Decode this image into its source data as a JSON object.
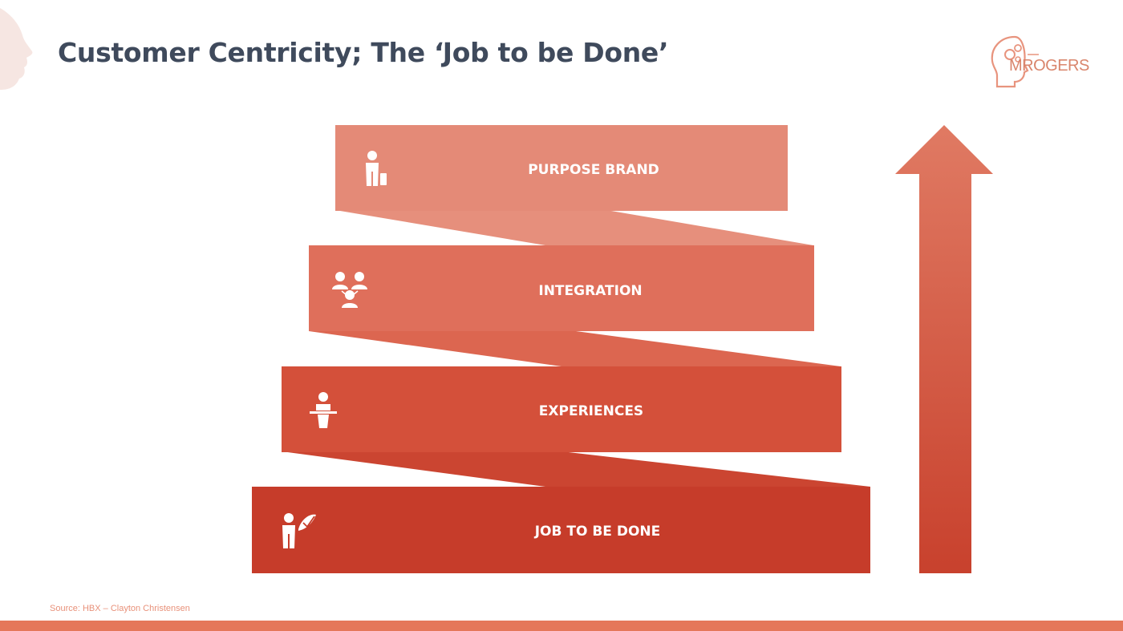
{
  "title": "Customer Centricity; The ‘Job to be Done’",
  "logo": {
    "text": "MROGERS"
  },
  "steps": [
    {
      "label": "PURPOSE BRAND",
      "icon": "businessman-icon",
      "color": "#e48a77"
    },
    {
      "label": "INTEGRATION",
      "icon": "group-network-icon",
      "color": "#df6f5b"
    },
    {
      "label": "EXPERIENCES",
      "icon": "speaker-podium-icon",
      "color": "#d4503a"
    },
    {
      "label": "JOB TO BE DONE",
      "icon": "person-checkmark-icon",
      "color": "#c63c2a"
    }
  ],
  "arrow": {
    "color_top": "#e07a63",
    "color_bottom": "#c8412d"
  },
  "source": "Source: HBX – Clayton Christensen",
  "colors": {
    "title": "#3f4a5c",
    "accent": "#e5775a"
  }
}
